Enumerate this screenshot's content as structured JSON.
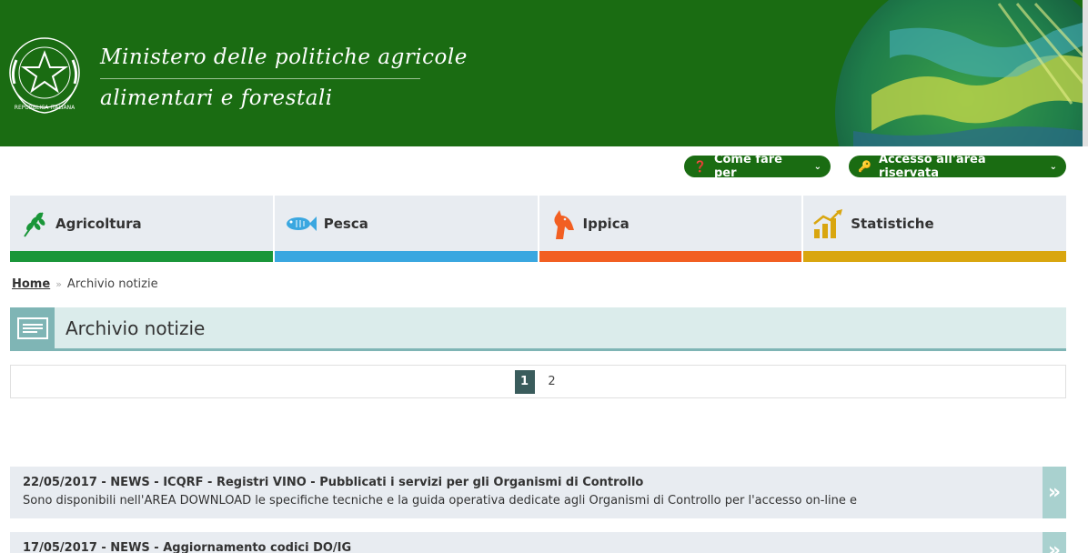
{
  "header": {
    "title_line1": "Ministero delle politiche agricole",
    "title_line2": "alimentari e forestali",
    "emblem_icon": "italian-republic-emblem-icon",
    "emblem_text": "REPUBBLICA ITALIANA"
  },
  "actions": {
    "how_to": "Come fare per",
    "reserved_area": "Accesso all'area riservata"
  },
  "categories": [
    {
      "label": "Agricoltura",
      "icon": "wheat-icon",
      "color": "#1a9639"
    },
    {
      "label": "Pesca",
      "icon": "fish-icon",
      "color": "#3aa7e0"
    },
    {
      "label": "Ippica",
      "icon": "horse-head-icon",
      "color": "#f25f22"
    },
    {
      "label": "Statistiche",
      "icon": "chart-growth-icon",
      "color": "#d9a60f"
    }
  ],
  "breadcrumb": {
    "home": "Home",
    "current": "Archivio notizie"
  },
  "section": {
    "title": "Archivio notizie"
  },
  "pager": {
    "pages": [
      "1",
      "2"
    ],
    "active": "1"
  },
  "news": [
    {
      "headline": "22/05/2017 - NEWS - ICQRF - Registri VINO - Pubblicati i servizi per gli Organismi di Controllo",
      "summary": "Sono disponibili nell'AREA DOWNLOAD le specifiche tecniche e la guida operativa dedicate agli Organismi di Controllo per l'accesso on-line e"
    },
    {
      "headline": "17/05/2017 - NEWS - Aggiornamento codici DO/IG",
      "summary": ""
    }
  ],
  "colors": {
    "header_green": "#1a6c12",
    "section_teal": "#7fb5b5",
    "tile_bg": "#e8ecf1"
  }
}
